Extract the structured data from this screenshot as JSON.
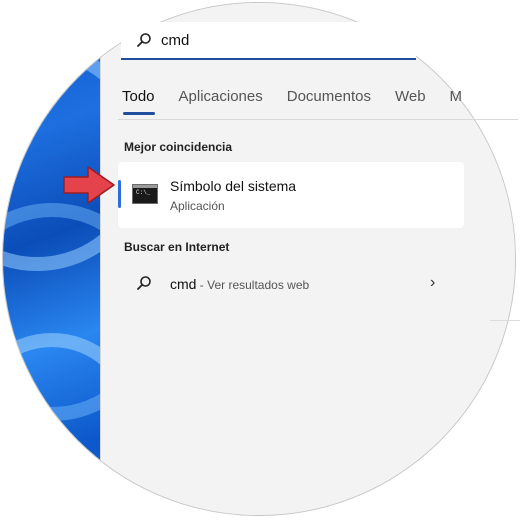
{
  "search": {
    "value": "cmd"
  },
  "tabs": [
    {
      "label": "Todo",
      "active": true
    },
    {
      "label": "Aplicaciones"
    },
    {
      "label": "Documentos"
    },
    {
      "label": "Web"
    },
    {
      "label": "M"
    }
  ],
  "best_match": {
    "section_title": "Mejor coincidencia",
    "title": "Símbolo del sistema",
    "subtitle": "Aplicación",
    "icon": "cmd-icon"
  },
  "internet": {
    "section_title": "Buscar en Internet",
    "query": "cmd",
    "suffix": " - Ver resultados web"
  },
  "colors": {
    "accent": "#2e6de0",
    "arrow": "#e5434c",
    "wallpaper": "#1e6fe0"
  }
}
